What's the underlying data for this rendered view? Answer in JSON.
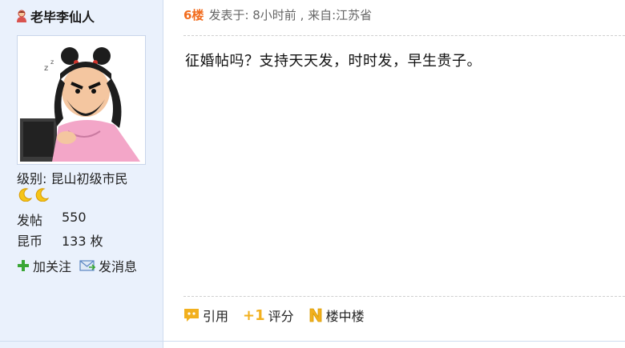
{
  "author": {
    "name": "老毕李仙人",
    "level_label": "级别:",
    "level_value": "昆山初级市民",
    "stats": [
      {
        "label": "发帖",
        "value": "550"
      },
      {
        "label": "昆币",
        "value": "133 枚"
      }
    ],
    "follow_label": "加关注",
    "message_label": "发消息"
  },
  "post": {
    "floor": "6楼",
    "meta": "发表于: 8小时前 , 来自:江苏省",
    "content": "征婚帖吗？支持天天发，时时发，早生贵子。"
  },
  "toolbar": {
    "quote_label": "引用",
    "rate_prefix": "+1",
    "rate_label": "评分",
    "reply_label": "楼中楼"
  },
  "colors": {
    "sidebar_bg": "#eaf1fc",
    "floor_accent": "#f26c1d",
    "icon_yellow": "#f2b01e",
    "follow_green": "#3aa635"
  }
}
